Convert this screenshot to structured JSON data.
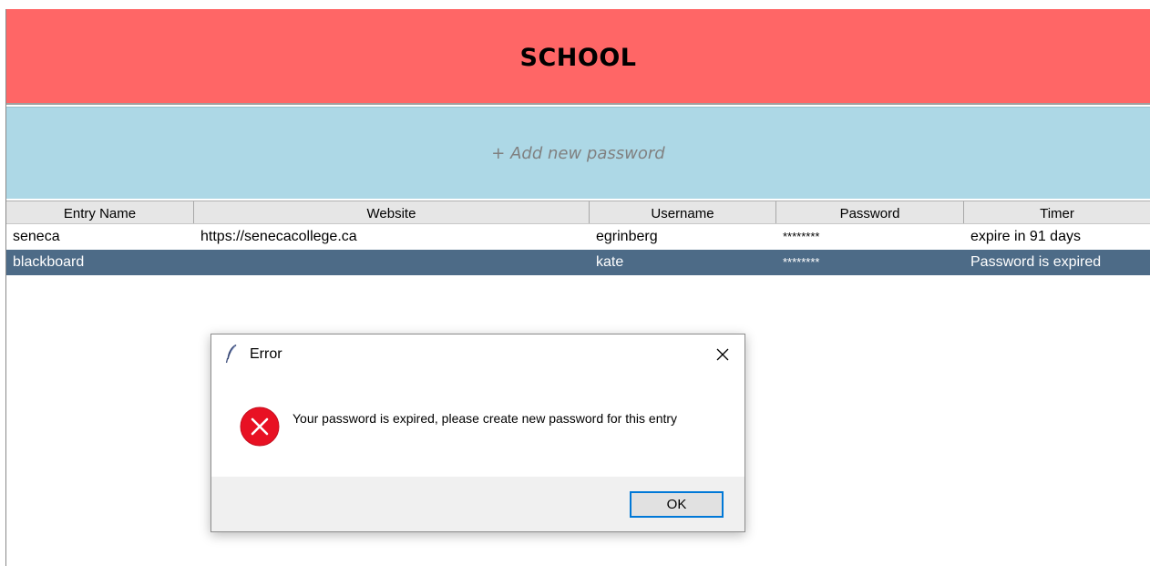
{
  "header": {
    "title": "SCHOOL",
    "color": "#ff6666"
  },
  "add_bar": {
    "label": "+ Add new password",
    "color": "#add8e6"
  },
  "table": {
    "columns": [
      "Entry Name",
      "Website",
      "Username",
      "Password",
      "Timer"
    ],
    "rows": [
      {
        "entry_name": "seneca",
        "website": "https://senecacollege.ca",
        "username": "egrinberg",
        "password": "********",
        "timer": "expire in 91 days",
        "selected": false
      },
      {
        "entry_name": "blackboard",
        "website": "",
        "username": "kate",
        "password": "********",
        "timer": "Password is expired",
        "selected": true
      }
    ],
    "selection_color": "#4d6b87"
  },
  "dialog": {
    "title": "Error",
    "title_icon": "feather-icon",
    "close_icon": "close-icon",
    "status_icon": "error-icon",
    "message": "Your password is expired, please create new password for this entry",
    "ok_label": "OK",
    "accent": "#0078d7",
    "error_color": "#e81123"
  }
}
